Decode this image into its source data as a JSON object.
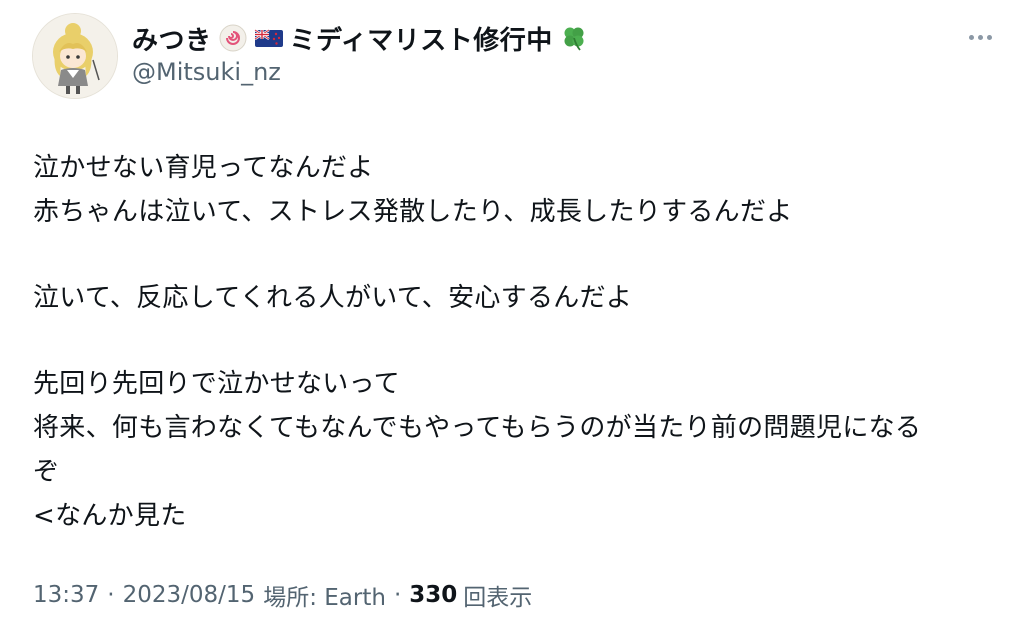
{
  "author": {
    "display_name": "みつき",
    "display_name_suffix": "ミディマリスト修行中",
    "handle": "@Mitsuki_nz",
    "icons": [
      "naruto-icon",
      "nz-flag-icon",
      "four-leaf-clover-icon"
    ]
  },
  "tweet": {
    "lines": [
      "泣かせない育児ってなんだよ",
      "赤ちゃんは泣いて、ストレス発散したり、成長したりするんだよ",
      "",
      "泣いて、反応してくれる人がいて、安心するんだよ",
      "",
      "先回り先回りで泣かせないって",
      "将来、何も言わなくてもなんでもやってもらうのが当たり前の問題児になる",
      "ぞ",
      "<なんか見た"
    ]
  },
  "meta": {
    "time": "13:37",
    "separator": "·",
    "date": "2023/08/15",
    "location_label": "場所: Earth",
    "views_count": "330",
    "views_label": "回表示"
  },
  "colors": {
    "text": "#0f1419",
    "secondary": "#536471"
  }
}
